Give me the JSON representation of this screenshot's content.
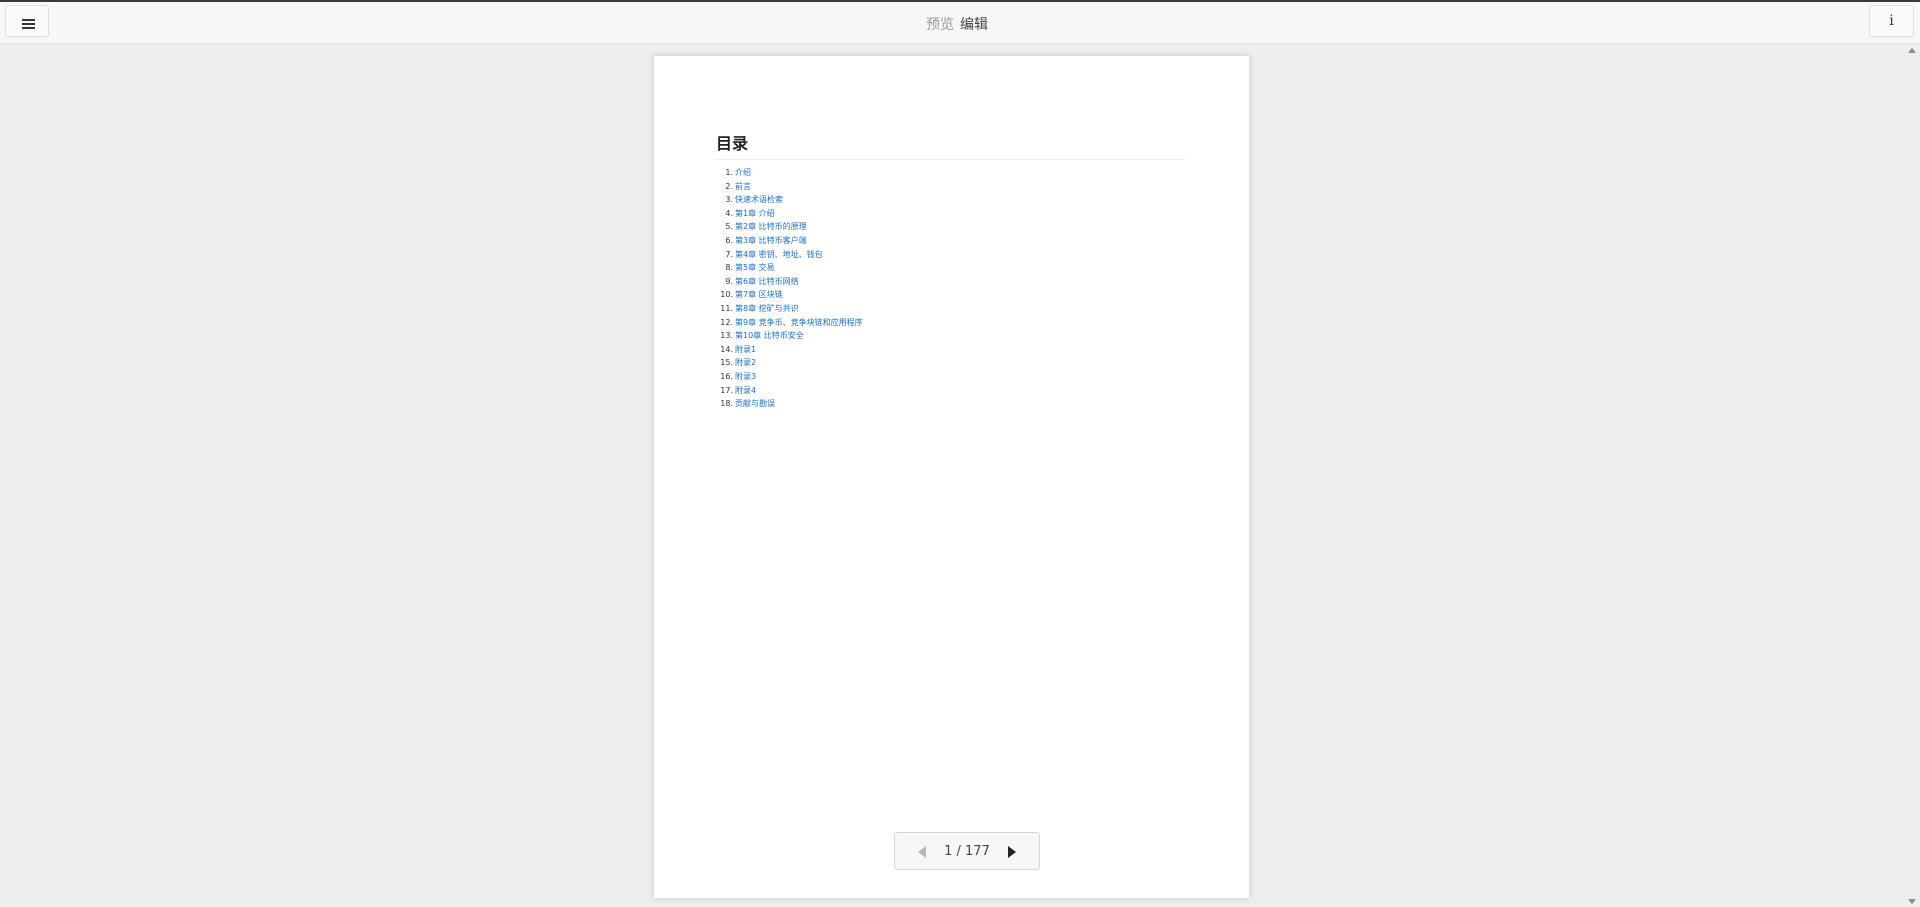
{
  "topbar": {
    "menu_icon": "hamburger-menu-icon",
    "mode_preview": "预览",
    "mode_edit": "编辑",
    "info_label": "i"
  },
  "document": {
    "toc_title": "目录",
    "toc_items": [
      {
        "num": "1.",
        "label": "介绍"
      },
      {
        "num": "2.",
        "label": "前言"
      },
      {
        "num": "3.",
        "label": "快速术语检索"
      },
      {
        "num": "4.",
        "label": "第1章 介绍"
      },
      {
        "num": "5.",
        "label": "第2章 比特币的原理"
      },
      {
        "num": "6.",
        "label": "第3章 比特币客户端"
      },
      {
        "num": "7.",
        "label": "第4章 密钥、地址、钱包"
      },
      {
        "num": "8.",
        "label": "第5章 交易"
      },
      {
        "num": "9.",
        "label": "第6章 比特币网络"
      },
      {
        "num": "10.",
        "label": "第7章 区块链"
      },
      {
        "num": "11.",
        "label": "第8章 挖矿与共识"
      },
      {
        "num": "12.",
        "label": "第9章 竞争币、竞争块链和应用程序"
      },
      {
        "num": "13.",
        "label": "第10章 比特币安全"
      },
      {
        "num": "14.",
        "label": "附录1"
      },
      {
        "num": "15.",
        "label": "附录2"
      },
      {
        "num": "16.",
        "label": "附录3"
      },
      {
        "num": "17.",
        "label": "附录4"
      },
      {
        "num": "18.",
        "label": "贡献与勘误"
      }
    ]
  },
  "pager": {
    "indicator": "1 / 177",
    "current_page": 1,
    "total_pages": 177,
    "prev_icon": "previous-page-icon",
    "next_icon": "next-page-icon"
  },
  "colors": {
    "link": "#1a6ec7",
    "background": "#eeeeee",
    "page": "#ffffff"
  }
}
